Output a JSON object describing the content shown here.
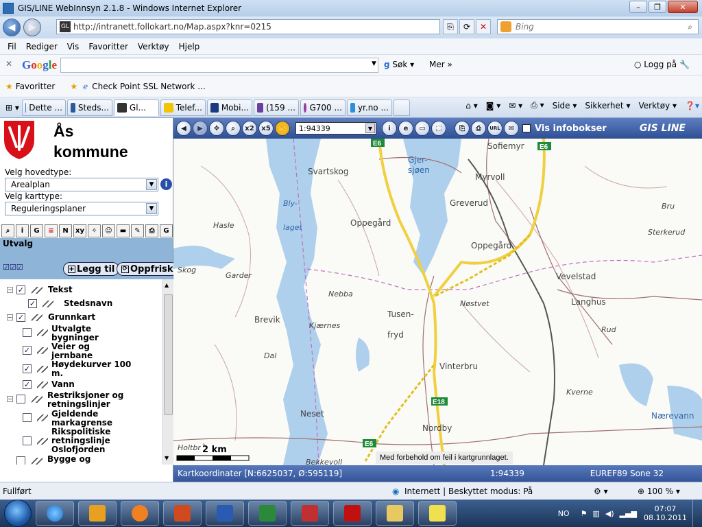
{
  "window": {
    "title": "GIS/LINE WebInnsyn 2.1.8 - Windows Internet Explorer",
    "minimize": "–",
    "maximize": "❐",
    "close": "✕"
  },
  "address": {
    "url": "http://intranett.follokart.no/Map.aspx?knr=0215",
    "search_placeholder": "Bing"
  },
  "menu": [
    "Fil",
    "Rediger",
    "Vis",
    "Favoritter",
    "Verktøy",
    "Hjelp"
  ],
  "google": {
    "logo": "Google",
    "search_label": "Søk",
    "more_label": "Mer",
    "login_label": "Logg på"
  },
  "favorites": {
    "label": "Favoritter",
    "link": "Check Point SSL Network ..."
  },
  "tabs": [
    {
      "label": "Dette ...",
      "color": "#3d7ad8"
    },
    {
      "label": "Steds...",
      "color": "#2a5aa0"
    },
    {
      "label": "Gl...",
      "color": "#333333"
    },
    {
      "label": "Telef...",
      "color": "#f2c500"
    },
    {
      "label": "Mobi...",
      "color": "#1b3b80"
    },
    {
      "label": "(159 ...",
      "color": "#6b3fa0"
    },
    {
      "label": "G700 ...",
      "color": "#9b3aa0"
    },
    {
      "label": "yr.no ...",
      "color": "#2f8ed8"
    }
  ],
  "toolbar_right": {
    "side": "Side",
    "safety": "Sikkerhet",
    "tools": "Verktøy"
  },
  "municipality": {
    "name_line1": "Ås",
    "name_line2": "kommune"
  },
  "sidebar": {
    "main_type_label": "Velg hovedtype:",
    "main_type_value": "Arealplan",
    "map_type_label": "Velg karttype:",
    "map_type_value": "Reguleringsplaner",
    "utvalg": "Utvalg",
    "add_button": "Legg til",
    "refresh_button": "Oppfrisk"
  },
  "layers": [
    {
      "label": "Tekst",
      "level": 0,
      "checked": true
    },
    {
      "label": "Stedsnavn",
      "level": 1,
      "checked": true
    },
    {
      "label": "Grunnkart",
      "level": 0,
      "checked": true
    },
    {
      "label": "Utvalgte bygninger",
      "level": 1,
      "checked": false
    },
    {
      "label": "Veier og jernbane",
      "level": 1,
      "checked": true
    },
    {
      "label": "Høydekurver 100 m.",
      "level": 1,
      "checked": true
    },
    {
      "label": "Vann",
      "level": 1,
      "checked": true
    },
    {
      "label": "Restriksjoner og retningslinjer",
      "level": 0,
      "checked": false
    },
    {
      "label": "Gjeldende markagrense",
      "level": 1,
      "checked": false
    },
    {
      "label": "Rikspolitiske retningslinje Oslofjorden",
      "level": 1,
      "checked": false
    },
    {
      "label": "Bygge og",
      "level": 0,
      "checked": false
    }
  ],
  "map": {
    "scale": "1:94339",
    "show_infoboxes": "Vis infobokser",
    "brand": "GIS LINE",
    "scalebar": "2 km",
    "disclaimer": "Med forbehold om feil i kartgrunnlaget.",
    "coords": "Kartkoordinater [N:6625037, Ø:595119]",
    "scale_status": "1:94339",
    "projection": "EUREF89 Sone 32",
    "road_labels": [
      "E6",
      "E6",
      "E18",
      "E6"
    ],
    "place_names": [
      "Sofiemyr",
      "Gjer-",
      "sjøen",
      "Svartskog",
      "Myrvoll",
      "Bly-",
      "laget",
      "Greverud",
      "Bru",
      "Oppegård",
      "Hasle",
      "Sterkerud",
      "Oppegård",
      "Skog",
      "Garder",
      "Vevelstad",
      "Nebba",
      "Nøstvet",
      "Langhus",
      "Tusen-",
      "fryd",
      "Brevik",
      "Kjærnes",
      "Rud",
      "Dal",
      "Vinterbru",
      "Kverne",
      "Neset",
      "Nærevann",
      "Nordby",
      "Holtbråten",
      "Bekkevoll"
    ]
  },
  "status": {
    "left": "Fullført",
    "zone": "Internett | Beskyttet modus: På",
    "zoom": "100 %"
  },
  "taskbar": {
    "lang": "NO",
    "time": "07:07",
    "date": "08.10.2011"
  }
}
